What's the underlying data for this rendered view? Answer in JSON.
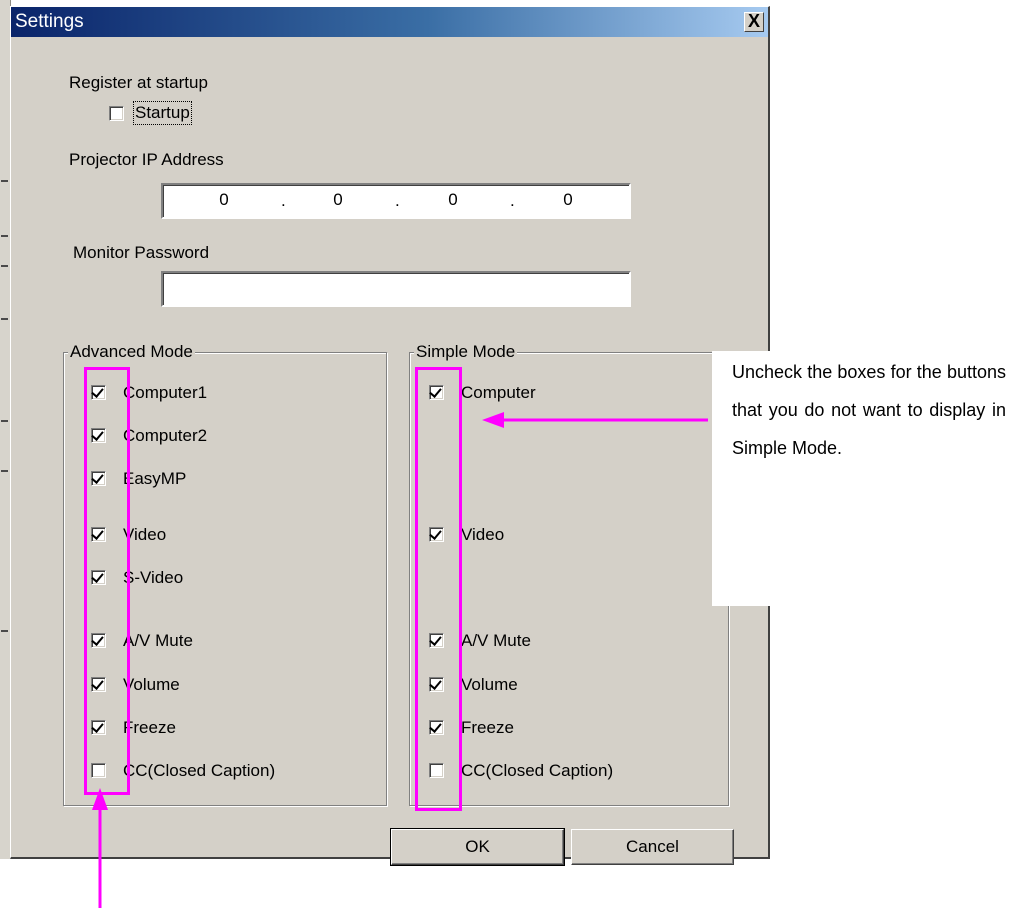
{
  "dialog": {
    "title": "Settings",
    "close_label": "X"
  },
  "startup": {
    "section_label": "Register at startup",
    "checkbox_label": "Startup",
    "checked": false
  },
  "ip": {
    "label": "Projector IP Address",
    "octets": [
      "0",
      "0",
      "0",
      "0"
    ],
    "separator": "."
  },
  "password": {
    "label": "Monitor Password",
    "value": ""
  },
  "advanced": {
    "title": "Advanced Mode",
    "items": [
      {
        "label": "Computer1",
        "checked": true
      },
      {
        "label": "Computer2",
        "checked": true
      },
      {
        "label": "EasyMP",
        "checked": true
      },
      {
        "label": "Video",
        "checked": true
      },
      {
        "label": "S-Video",
        "checked": true
      },
      {
        "label": "A/V Mute",
        "checked": true
      },
      {
        "label": "Volume",
        "checked": true
      },
      {
        "label": "Freeze",
        "checked": true
      },
      {
        "label": "CC(Closed Caption)",
        "checked": false
      }
    ]
  },
  "simple": {
    "title": "Simple Mode",
    "items": [
      {
        "label": "Computer",
        "checked": true
      },
      {
        "label": "Video",
        "checked": true
      },
      {
        "label": "A/V Mute",
        "checked": true
      },
      {
        "label": "Volume",
        "checked": true
      },
      {
        "label": "Freeze",
        "checked": true
      },
      {
        "label": "CC(Closed Caption)",
        "checked": false
      }
    ]
  },
  "buttons": {
    "ok": "OK",
    "cancel": "Cancel"
  },
  "annotation": {
    "text": "Uncheck the boxes for the buttons that you do not want to display in Simple Mode.",
    "highlight_color": "#ff00ff"
  }
}
